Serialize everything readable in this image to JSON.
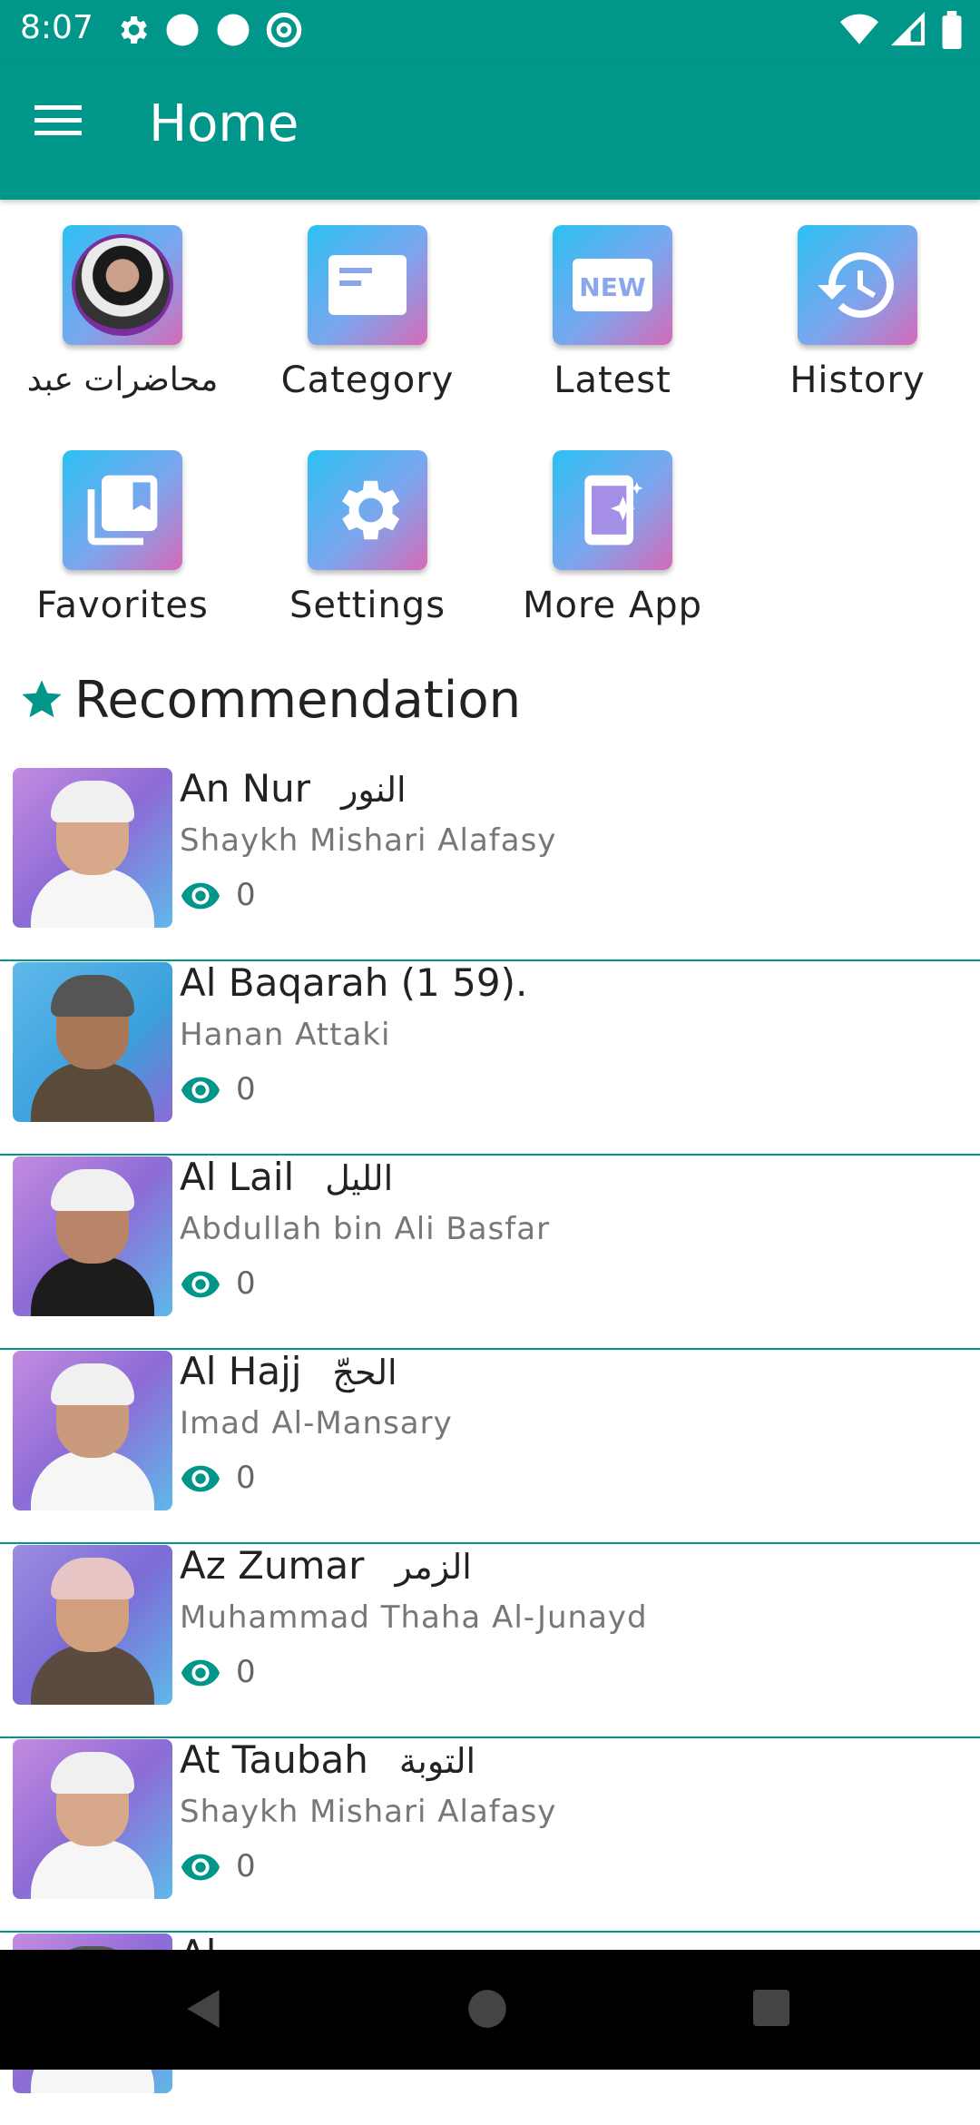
{
  "status_bar": {
    "time": "8:07",
    "left_icons": [
      "gear-icon",
      "circle-icon",
      "circle-icon",
      "at-sign-icon"
    ],
    "right_icons": [
      "wifi-icon",
      "signal-icon",
      "battery-icon"
    ]
  },
  "app_bar": {
    "title": "Home",
    "menu_icon": "hamburger-menu-icon",
    "color": "#00968a"
  },
  "grid": [
    {
      "label": "محاضرات عبد",
      "icon": "avatar-image"
    },
    {
      "label": "Category",
      "icon": "category-card-icon"
    },
    {
      "label": "Latest",
      "icon": "new-badge-icon"
    },
    {
      "label": "History",
      "icon": "history-clock-icon"
    },
    {
      "label": "Favorites",
      "icon": "bookmark-library-icon"
    },
    {
      "label": "Settings",
      "icon": "gear-icon"
    },
    {
      "label": "More App",
      "icon": "phone-sparkle-icon"
    }
  ],
  "recommendation": {
    "title": "Recommendation",
    "icon": "star-icon"
  },
  "list": [
    {
      "title": "An Nur",
      "arabic": "النور",
      "reciter": "Shaykh Mishari Alafasy",
      "views": "0"
    },
    {
      "title": "Al Baqarah (1 59).",
      "arabic": "",
      "reciter": "Hanan Attaki",
      "views": "0"
    },
    {
      "title": "Al Lail",
      "arabic": "الليل",
      "reciter": "Abdullah bin Ali Basfar",
      "views": "0"
    },
    {
      "title": "Al Hajj",
      "arabic": "الحجّ",
      "reciter": "Imad Al-Mansary",
      "views": "0"
    },
    {
      "title": "Az Zumar",
      "arabic": "الزمر",
      "reciter": "Muhammad Thaha Al-Junayd",
      "views": "0"
    },
    {
      "title": "At Taubah",
      "arabic": "التوبة",
      "reciter": "Shaykh Mishari Alafasy",
      "views": "0"
    },
    {
      "title": "Al-...",
      "arabic": "",
      "reciter": "",
      "views": ""
    }
  ],
  "nav_bar": {
    "back": "back-triangle-icon",
    "home": "home-circle-icon",
    "recents": "recents-square-icon"
  }
}
